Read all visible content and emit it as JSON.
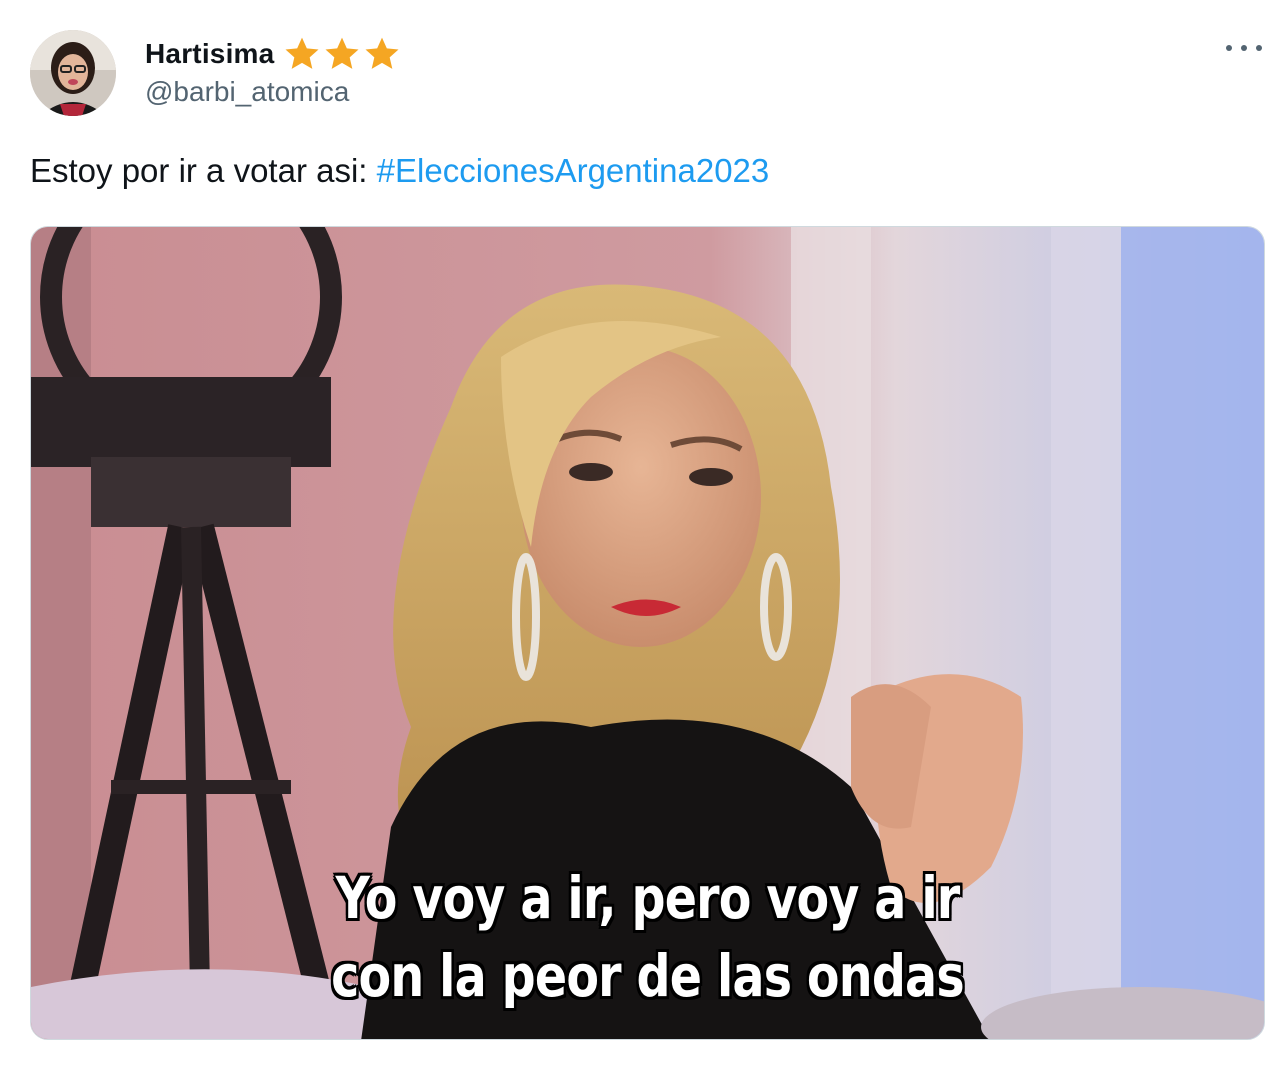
{
  "user": {
    "display_name": "Hartisima",
    "handle": "@barbi_atomica",
    "badge_icons": [
      "star-icon",
      "star-icon",
      "star-icon"
    ],
    "badge_color": "#f5a623"
  },
  "menu": {
    "more_icon": "more-horizontal-icon"
  },
  "tweet": {
    "text": "Estoy por ir a votar asi: ",
    "hashtag": "#EleccionesArgentina2023",
    "hashtag_color": "#1d9bf0"
  },
  "media": {
    "caption_line_1": "Yo voy a ir, pero voy a ir",
    "caption_line_2": "con la peor de las ondas"
  }
}
